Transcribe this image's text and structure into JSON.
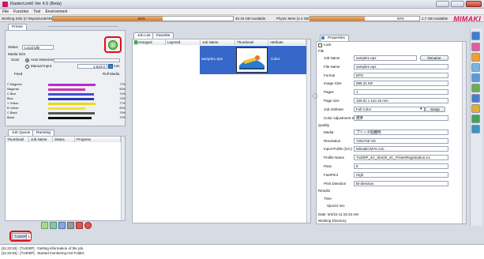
{
  "window": {
    "title": "RasterLink6 Ver 4.5 (Beta)"
  },
  "menu": [
    "File",
    "Function",
    "Tool",
    "Environment"
  ],
  "status": {
    "working_dir": "Working Disk (C:\\MySubJobs\\RL6\\)",
    "disk_usage_pct": "61%",
    "disk_available": "40.15 GB Available",
    "mem_label": "Physic Mem (2.4 GB)",
    "mem_usage_pct": "50%",
    "mem_available": "1.7 GB Available",
    "disk_fill": 0.61,
    "mem_fill": 0.5
  },
  "brand": "MIMAKI",
  "printer_panel": {
    "tab": "Printer",
    "status_label": "Status",
    "status_value": "Local Idle",
    "media_size_label": "Media Size",
    "scan_label": "Scan",
    "auto_detection": "Auto Detection",
    "manual_input": "Manual Input",
    "manual_value": "1,610.0",
    "unit": "mm",
    "feed_label": "Feed",
    "feed_value": "Roll Media"
  },
  "inks": [
    {
      "name": "C Magenta",
      "pct": "77%",
      "fill": 0.77,
      "color": "#b42bd0"
    },
    {
      "name": "Magenta",
      "pct": "60%",
      "fill": 0.6,
      "color": "#d233a8"
    },
    {
      "name": "C Blue",
      "pct": "74%",
      "fill": 0.74,
      "color": "#3f4fd6"
    },
    {
      "name": "Blue",
      "pct": "74%",
      "fill": 0.74,
      "color": "#2a36a8"
    },
    {
      "name": "Y Yellow",
      "pct": "77%",
      "fill": 0.77,
      "color": "#e8d81a"
    },
    {
      "name": "B Yellow",
      "pct": "60%",
      "fill": 0.6,
      "color": "#f0e040"
    },
    {
      "name": "C Black",
      "pct": "75%",
      "fill": 0.75,
      "color": "#555555"
    },
    {
      "name": "Black",
      "pct": "70%",
      "fill": 0.7,
      "color": "#111111"
    }
  ],
  "queue": {
    "tab_job_queue": "Job Queue",
    "tab_running": "Running",
    "columns": [
      "Thumbnail",
      "Job Name",
      "Status",
      "Progress"
    ]
  },
  "joblist": {
    "tab_job_list": "Job List",
    "tab_favorite": "Favorite",
    "columns": [
      "Arranged",
      "Layered",
      "Job Name",
      "Thumbnail",
      "Attribute"
    ],
    "rows": [
      {
        "job_name": "sample1.eps",
        "attribute": "Color"
      }
    ]
  },
  "properties": {
    "tab": "Properties",
    "lock_label": "Lock",
    "file_section": "File",
    "job_name_label": "Job Name",
    "job_name": "sample1.eps",
    "rename": "Rename",
    "file_name_label": "File Name",
    "file_name": "sample1.eps",
    "format_label": "Format",
    "format": "EPS",
    "image_size_label": "Image Size",
    "image_size": "895.31 KB",
    "pages_label": "Pages",
    "pages": "1",
    "page_size_label": "Page size",
    "page_size": "165.61 x 110.16 mm",
    "job_attribute_label": "Job Attribute",
    "job_attribute": "Full Color",
    "setup": "Setup",
    "color_adj_label": "Color Adjustment Set",
    "color_adj": "標準",
    "quality_section": "Quality",
    "media_label": "Media",
    "media": "プリンタ個體時",
    "resolution_label": "Resolution",
    "resolution": "720x720 VD",
    "input_profile_label": "Input Profile (ICC)",
    "input_profile": "MimakiCMYK.icm",
    "profile_name_label": "Profile Name",
    "profile_name": "Tx300P_4C_Sb420_4C_PrinterRegistration.icc",
    "pass_label": "Pass",
    "pass": "8",
    "fast_print_label": "FastPrint",
    "fast_print": "High",
    "print_direction_label": "Print Direction",
    "print_direction": "Bi-direction",
    "results_section": "Results",
    "time_label": "Time",
    "spool_label": "Spool",
    "spool": "2 sec",
    "date_line": "Date: 6/4/15 11:15:33 AM",
    "working_dir_line": "Working Directory"
  },
  "printer_tab": {
    "label": "Tx300P",
    "badge": "1"
  },
  "log": [
    "[11:22:53] : [Tx300P] : Getting information of the job.",
    "[11:22:53] : [Tx300P] : Started monitoring Hot Folder."
  ],
  "colors": {
    "brand": "#d4145a",
    "highlight": "#e01010",
    "meter_fill": "#e07b1e"
  }
}
